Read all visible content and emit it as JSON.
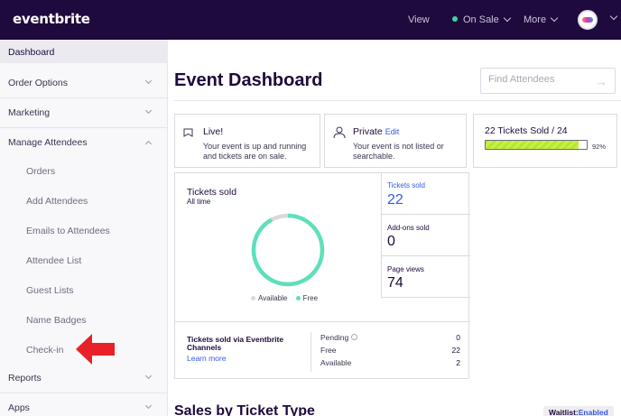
{
  "topbar": {
    "logo": "eventbrite",
    "nav_view": "View",
    "nav_status": "On Sale",
    "nav_more": "More",
    "status_color": "#3cd3a3"
  },
  "sidebar": {
    "dashboard": "Dashboard",
    "order_options": "Order Options",
    "marketing": "Marketing",
    "manage_attendees": "Manage Attendees",
    "sub_items": [
      "Orders",
      "Add Attendees",
      "Emails to Attendees",
      "Attendee List",
      "Guest Lists",
      "Name Badges",
      "Check-in"
    ],
    "reports": "Reports",
    "apps": "Apps"
  },
  "main": {
    "page_title": "Event Dashboard",
    "search_placeholder": "Find Attendees",
    "live_card": {
      "title": "Live!",
      "description": "Your event is up and running and tickets are on sale."
    },
    "private_card": {
      "title": "Private",
      "edit_link": "Edit",
      "description": "Your event is not listed or searchable."
    },
    "sold_card": {
      "title": "22 Tickets Sold / 24",
      "percent_label": "92%",
      "progress_fraction": 0.92
    },
    "tickets_chart": {
      "title": "Tickets sold",
      "subtitle": "All time",
      "legend_available": "Available",
      "legend_free": "Free",
      "available_color": "#d9d9d9",
      "free_color": "#5de0bb"
    },
    "stats": {
      "tickets_sold_label": "Tickets sold",
      "tickets_sold_value": "22",
      "addons_label": "Add-ons sold",
      "addons_value": "0",
      "page_views_label": "Page views",
      "page_views_value": "74"
    },
    "channels": {
      "title": "Tickets sold via Eventbrite Channels",
      "learn_more": "Learn more",
      "pending_label": "Pending",
      "pending_value": "0",
      "free_label": "Free",
      "free_value": "22",
      "available_label": "Available",
      "available_value": "2"
    },
    "section_title": "Sales by Ticket Type",
    "waitlist_label": "Waitlist:",
    "waitlist_value": "Enabled"
  }
}
